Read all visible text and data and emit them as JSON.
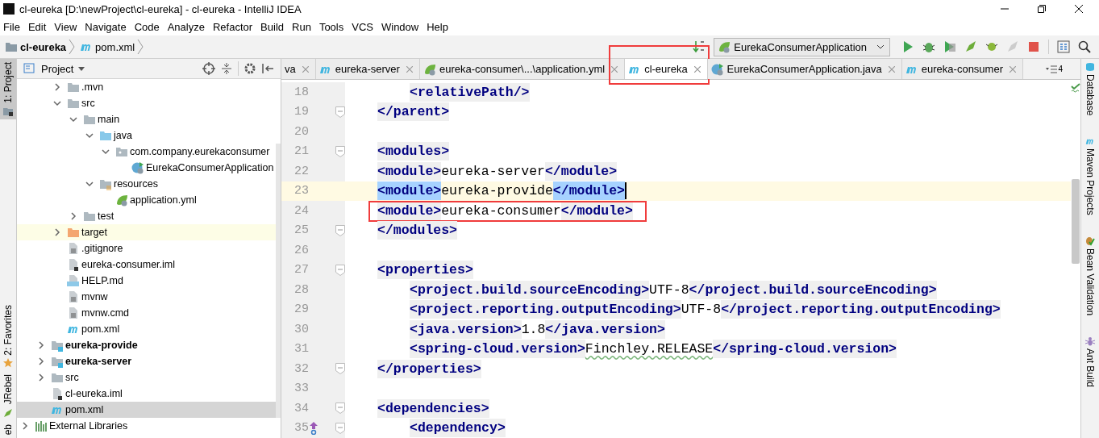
{
  "window": {
    "title": "cl-eureka [D:\\newProject\\cl-eureka] - cl-eureka - IntelliJ IDEA"
  },
  "menu": [
    "File",
    "Edit",
    "View",
    "Navigate",
    "Code",
    "Analyze",
    "Refactor",
    "Build",
    "Run",
    "Tools",
    "VCS",
    "Window",
    "Help"
  ],
  "breadcrumb": [
    {
      "label": "cl-eureka",
      "kind": "module"
    },
    {
      "label": "pom.xml",
      "kind": "maven"
    }
  ],
  "run_config": {
    "label": "EurekaConsumerApplication"
  },
  "left_stripe": [
    {
      "label": "1: Project",
      "selected": true,
      "kind": "project"
    },
    {
      "label": "2: Favorites",
      "selected": false,
      "kind": "star"
    },
    {
      "label": "JRebel",
      "selected": false,
      "kind": "rocket"
    },
    {
      "label": "eb",
      "selected": false,
      "kind": "none"
    }
  ],
  "right_stripe": [
    {
      "label": "Database",
      "kind": "database"
    },
    {
      "label": "Maven Projects",
      "kind": "maven"
    },
    {
      "label": "Bean Validation",
      "kind": "bean"
    },
    {
      "label": "Ant Build",
      "kind": "ant"
    }
  ],
  "project": {
    "title": "Project",
    "tree": [
      {
        "children": [
          {
            "children": [
              {
                "label": ".mvn",
                "kind": "folder",
                "expanded": false,
                "selected": false
              },
              {
                "label": "src",
                "kind": "folder",
                "expanded": true,
                "selected": false,
                "children": [
                  {
                    "label": "main",
                    "kind": "folder",
                    "expanded": true,
                    "selected": false,
                    "children": [
                      {
                        "label": "java",
                        "kind": "source-folder",
                        "expanded": true,
                        "selected": false,
                        "children": [
                          {
                            "label": "com.company.eurekaconsumer",
                            "kind": "package",
                            "expanded": true,
                            "selected": false,
                            "children": [
                              {
                                "label": "EurekaConsumerApplication",
                                "kind": "spring-class",
                                "selected": false
                              }
                            ]
                          }
                        ]
                      },
                      {
                        "label": "resources",
                        "kind": "resources-folder",
                        "expanded": true,
                        "selected": false,
                        "children": [
                          {
                            "label": "application.yml",
                            "kind": "spring-file",
                            "selected": false
                          }
                        ]
                      }
                    ]
                  },
                  {
                    "label": "test",
                    "kind": "folder",
                    "expanded": false,
                    "selected": false
                  }
                ]
              },
              {
                "label": "target",
                "kind": "excluded-folder",
                "expanded": false,
                "selected": false
              },
              {
                "label": ".gitignore",
                "kind": "text-file",
                "selected": false
              },
              {
                "label": "eureka-consumer.iml",
                "kind": "iml-file",
                "selected": false
              },
              {
                "label": "HELP.md",
                "kind": "md-file",
                "selected": false
              },
              {
                "label": "mvnw",
                "kind": "text-file",
                "selected": false
              },
              {
                "label": "mvnw.cmd",
                "kind": "text-file",
                "selected": false
              },
              {
                "label": "pom.xml",
                "kind": "maven",
                "selected": false
              }
            ]
          },
          {
            "label": "eureka-provide",
            "kind": "module",
            "expanded": false,
            "selected": false
          },
          {
            "label": "eureka-server",
            "kind": "module",
            "expanded": false,
            "selected": false
          },
          {
            "label": "src",
            "kind": "folder",
            "expanded": false,
            "selected": false
          },
          {
            "label": "cl-eureka.iml",
            "kind": "iml-file",
            "selected": false
          },
          {
            "label": "pom.xml",
            "kind": "maven",
            "selected": true
          }
        ]
      },
      {
        "label": "External Libraries",
        "kind": "libraries",
        "expanded": false,
        "selected": false
      }
    ]
  },
  "editor_tabs": [
    {
      "label": "va",
      "kind": "none",
      "selected": false,
      "annotated": false
    },
    {
      "label": "eureka-server",
      "kind": "maven",
      "selected": false,
      "annotated": false
    },
    {
      "label": "eureka-consumer\\...\\application.yml",
      "kind": "spring-file",
      "selected": false,
      "annotated": false
    },
    {
      "label": "cl-eureka",
      "kind": "maven",
      "selected": true,
      "annotated": true
    },
    {
      "label": "EurekaConsumerApplication.java",
      "kind": "spring-class",
      "selected": false,
      "annotated": false
    },
    {
      "label": "eureka-consumer",
      "kind": "maven",
      "selected": false,
      "annotated": false
    }
  ],
  "tab_overflow": "4",
  "code": [
    {
      "children": [
        {
          "number": "18",
          "fold": false,
          "current": false,
          "caret": false,
          "annotated": false,
          "gutter_icon": false,
          "tokens": [
            {
              "kind": "tag",
              "text": "<relativePath/>"
            }
          ]
        }
      ]
    },
    {
      "number": "19",
      "fold": true,
      "current": false,
      "caret": false,
      "annotated": false,
      "gutter_icon": false,
      "tokens": [
        {
          "kind": "tag",
          "text": "</parent>"
        }
      ]
    },
    {
      "number": "20",
      "fold": false,
      "current": false,
      "caret": false,
      "annotated": false,
      "gutter_icon": false
    },
    {
      "number": "21",
      "fold": true,
      "current": false,
      "caret": false,
      "annotated": false,
      "gutter_icon": false,
      "tokens": [
        {
          "kind": "tag",
          "text": "<modules>"
        }
      ]
    },
    {
      "number": "22",
      "fold": false,
      "current": false,
      "caret": false,
      "annotated": false,
      "gutter_icon": false,
      "tokens": [
        {
          "kind": "tag",
          "text": "<module>"
        },
        {
          "kind": "text",
          "text": "eureka-server"
        },
        {
          "kind": "tag",
          "text": "</module>"
        }
      ]
    },
    {
      "number": "23",
      "fold": false,
      "current": true,
      "caret": true,
      "annotated": false,
      "gutter_icon": false,
      "tokens": [
        {
          "kind": "tag-selected",
          "text": "<module>"
        },
        {
          "kind": "text",
          "text": "eureka-provide"
        },
        {
          "kind": "tag-selected",
          "text": "</module>"
        }
      ]
    },
    {
      "number": "24",
      "fold": false,
      "current": false,
      "caret": false,
      "annotated": true,
      "gutter_icon": false,
      "tokens": [
        {
          "kind": "tag",
          "text": "<module>"
        },
        {
          "kind": "text",
          "text": "eureka-consumer"
        },
        {
          "kind": "tag",
          "text": "</module>"
        }
      ]
    },
    {
      "number": "25",
      "fold": true,
      "current": false,
      "caret": false,
      "annotated": false,
      "gutter_icon": false,
      "tokens": [
        {
          "kind": "tag",
          "text": "</modules>"
        }
      ]
    },
    {
      "number": "26",
      "fold": false,
      "current": false,
      "caret": false,
      "annotated": false,
      "gutter_icon": false
    },
    {
      "number": "27",
      "fold": true,
      "current": false,
      "caret": false,
      "annotated": false,
      "gutter_icon": false,
      "tokens": [
        {
          "kind": "tag",
          "text": "<properties>"
        }
      ],
      "children": [
        {
          "number": "28",
          "fold": false,
          "current": false,
          "caret": false,
          "annotated": false,
          "gutter_icon": false,
          "tokens": [
            {
              "kind": "tag",
              "text": "<project.build.sourceEncoding>"
            },
            {
              "kind": "text",
              "text": "UTF-8"
            },
            {
              "kind": "tag",
              "text": "</project.build.sourceEncoding>"
            }
          ]
        },
        {
          "number": "29",
          "fold": false,
          "current": false,
          "caret": false,
          "annotated": false,
          "gutter_icon": false,
          "tokens": [
            {
              "kind": "tag",
              "text": "<project.reporting.outputEncoding>"
            },
            {
              "kind": "text",
              "text": "UTF-8"
            },
            {
              "kind": "tag",
              "text": "</project.reporting.outputEncoding>"
            }
          ]
        },
        {
          "number": "30",
          "fold": false,
          "current": false,
          "caret": false,
          "annotated": false,
          "gutter_icon": false,
          "tokens": [
            {
              "kind": "tag",
              "text": "<java.version>"
            },
            {
              "kind": "text",
              "text": "1.8"
            },
            {
              "kind": "tag",
              "text": "</java.version>"
            }
          ]
        },
        {
          "number": "31",
          "fold": false,
          "current": false,
          "caret": false,
          "annotated": false,
          "gutter_icon": false,
          "tokens": [
            {
              "kind": "tag",
              "text": "<spring-cloud.version>"
            },
            {
              "kind": "text-typo",
              "text": "Finchley.RELEASE"
            },
            {
              "kind": "tag",
              "text": "</spring-cloud.version>"
            }
          ]
        }
      ]
    },
    {
      "number": "32",
      "fold": true,
      "current": false,
      "caret": false,
      "annotated": false,
      "gutter_icon": false,
      "tokens": [
        {
          "kind": "tag",
          "text": "</properties>"
        }
      ]
    },
    {
      "number": "33",
      "fold": false,
      "current": false,
      "caret": false,
      "annotated": false,
      "gutter_icon": false
    },
    {
      "number": "34",
      "fold": true,
      "current": false,
      "caret": false,
      "annotated": false,
      "gutter_icon": false,
      "tokens": [
        {
          "kind": "tag",
          "text": "<dependencies>"
        }
      ],
      "children": [
        {
          "number": "35",
          "fold": true,
          "current": false,
          "caret": false,
          "annotated": false,
          "gutter_icon": true,
          "tokens": [
            {
              "kind": "tag",
              "text": "<dependency>"
            }
          ]
        }
      ]
    }
  ]
}
